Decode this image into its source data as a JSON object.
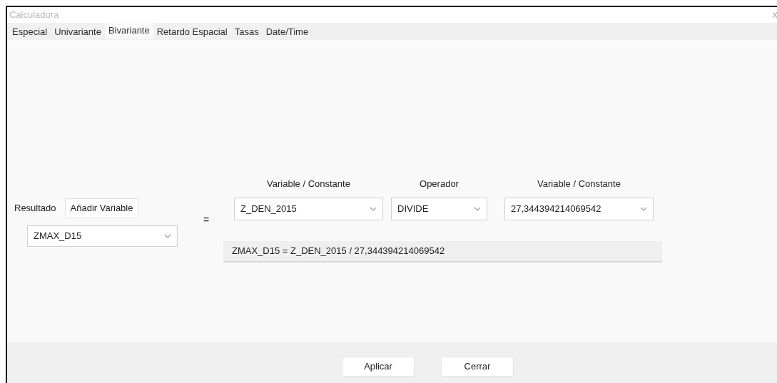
{
  "window": {
    "title": "Calculadora"
  },
  "tabs": [
    {
      "label": "Especial",
      "selected": false
    },
    {
      "label": "Univariante",
      "selected": false
    },
    {
      "label": "Bivariante",
      "selected": true
    },
    {
      "label": "Retardo Espacial",
      "selected": false
    },
    {
      "label": "Tasas",
      "selected": false
    },
    {
      "label": "Date/Time",
      "selected": false
    }
  ],
  "result": {
    "label": "Resultado",
    "add_button": "Añadir Variable",
    "value": "ZMAX_D15"
  },
  "equals": "=",
  "operand_1": {
    "label": "Variable / Constante",
    "value": "Z_DEN_2015"
  },
  "operator": {
    "label": "Operador",
    "value": "DIVIDE"
  },
  "operand_2": {
    "label": "Variable / Constante",
    "value": "27,344394214069542"
  },
  "formula": "ZMAX_D15 = Z_DEN_2015 / 27,344394214069542",
  "buttons": [
    "Aplicar",
    "Cerrar"
  ]
}
